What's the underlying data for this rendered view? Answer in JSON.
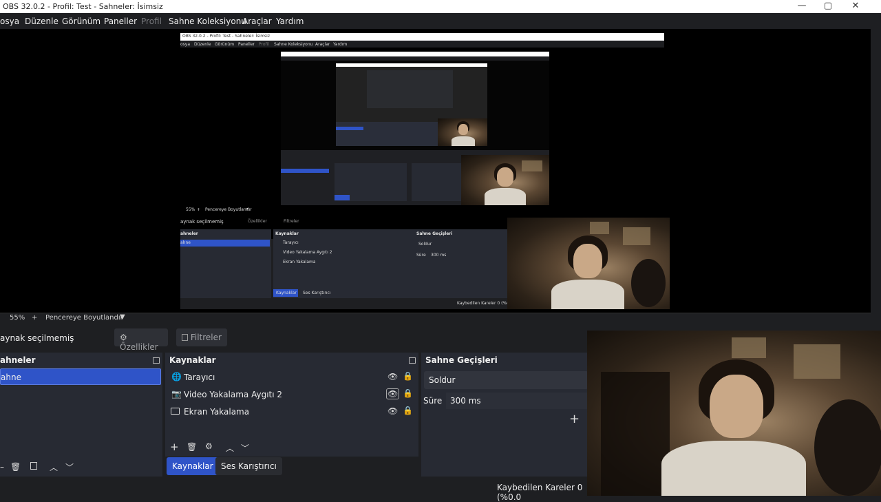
{
  "window": {
    "title": "OBS 32.0.2 - Profil: Test - Sahneler: İsimsiz",
    "minimize": "—",
    "maximize": "▢",
    "close": "✕"
  },
  "menu": [
    "osya",
    "Düzenle",
    "Görünüm",
    "Paneller",
    "Profil",
    "Sahne Koleksiyonu",
    "Araçlar",
    "Yardım"
  ],
  "preview": {
    "zoom": "55%",
    "plus": "+",
    "resize_label": "Pencereye Boyutlandır",
    "nested_title": "OBS 32.0.2 - Profil: Test - Sahneler: İsimsiz",
    "nested_menu": [
      "osya",
      "Düzenle",
      "Görünüm",
      "Paneller",
      "Profil",
      "Sahne Koleksiyonu",
      "Araçlar",
      "Yardım"
    ],
    "nested_zoom": "55%",
    "nested_resize": "Pencereye Boyutlandır",
    "nested_no_source": "aynak seçilmemiş",
    "nested_props": "Özellikler",
    "nested_filters": "Filtreler",
    "nested_scenes": "ahneler",
    "nested_scene_item": "ahne",
    "nested_sources_header": "Kaynaklar",
    "nested_sources": [
      "Tarayıcı",
      "Video Yakalama Aygıtı 2",
      "Ekran Yakalama"
    ],
    "nested_transitions_header": "Sahne Geçişleri",
    "nested_transition": "Soldur",
    "nested_duration_label": "Süre",
    "nested_duration": "300 ms",
    "nested_tab_sources": "Kaynaklar",
    "nested_tab_mixer": "Ses Karıştırıcı",
    "nested_dropped": "Kaybedilen Kareler 0 (%0.0"
  },
  "toolbar": {
    "no_source": "aynak seçilmemiş",
    "properties": "Özellikler",
    "filters": "Filtreler"
  },
  "scenes": {
    "header": "ahneler",
    "items": [
      "ahne"
    ]
  },
  "sources": {
    "header": "Kaynaklar",
    "items": [
      {
        "name": "Tarayıcı",
        "icon": "globe-icon"
      },
      {
        "name": "Video Yakalama Aygıtı 2",
        "icon": "camera-icon"
      },
      {
        "name": "Ekran Yakalama",
        "icon": "monitor-icon"
      }
    ]
  },
  "transitions": {
    "header": "Sahne Geçişleri",
    "type": "Soldur",
    "duration_label": "Süre",
    "duration": "300 ms",
    "add": "+"
  },
  "dock_tabs": {
    "sources": "Kaynaklar",
    "mixer": "Ses Karıştırıcı"
  },
  "status": {
    "dropped_frames": "Kaybedilen Kareler 0 (%0.0"
  },
  "colors": {
    "accent": "#2f54c8",
    "panel": "#272a33",
    "background": "#1e1f22"
  }
}
